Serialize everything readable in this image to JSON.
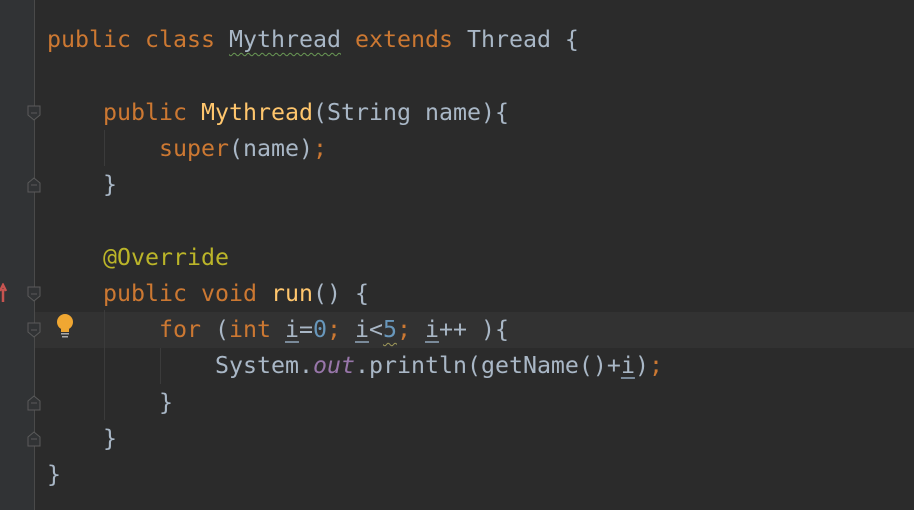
{
  "editor": {
    "colors": {
      "keyword": "#cc7832",
      "method": "#ffc66d",
      "number": "#6897bb",
      "annotation": "#bbb529",
      "field": "#9876aa",
      "text": "#a9b7c6",
      "background": "#2b2b2b"
    },
    "current_line": 9,
    "gutter_icons": {
      "line8": "override-arrow-icon",
      "line9": "lightbulb-icon"
    },
    "lines": [
      [
        {
          "c": "kw",
          "t": "public class "
        },
        {
          "c": "warn",
          "t": "Mythread"
        },
        {
          "c": "kw",
          "t": " extends "
        },
        {
          "c": "",
          "t": "Thread {"
        }
      ],
      [],
      [
        {
          "c": "",
          "t": "    "
        },
        {
          "c": "kw",
          "t": "public "
        },
        {
          "c": "fn",
          "t": "Mythread"
        },
        {
          "c": "",
          "t": "(String name){"
        }
      ],
      [
        {
          "c": "",
          "t": "        "
        },
        {
          "c": "kw",
          "t": "super"
        },
        {
          "c": "",
          "t": "(name)"
        },
        {
          "c": "kw",
          "t": ";"
        }
      ],
      [
        {
          "c": "",
          "t": "    }"
        }
      ],
      [],
      [
        {
          "c": "",
          "t": "    "
        },
        {
          "c": "ann",
          "t": "@Override"
        }
      ],
      [
        {
          "c": "",
          "t": "    "
        },
        {
          "c": "kw",
          "t": "public void "
        },
        {
          "c": "fn",
          "t": "run"
        },
        {
          "c": "",
          "t": "() {"
        }
      ],
      [
        {
          "c": "",
          "t": "        "
        },
        {
          "c": "kw",
          "t": "for "
        },
        {
          "c": "",
          "t": "("
        },
        {
          "c": "kw",
          "t": "int "
        },
        {
          "c": "var",
          "t": "i"
        },
        {
          "c": "",
          "t": "="
        },
        {
          "c": "num",
          "t": "0"
        },
        {
          "c": "kw",
          "t": "; "
        },
        {
          "c": "var",
          "t": "i"
        },
        {
          "c": "",
          "t": "<"
        },
        {
          "c": "num weak",
          "t": "5"
        },
        {
          "c": "kw",
          "t": "; "
        },
        {
          "c": "var",
          "t": "i"
        },
        {
          "c": "",
          "t": "++ ){"
        }
      ],
      [
        {
          "c": "",
          "t": "            System."
        },
        {
          "c": "fld",
          "t": "out"
        },
        {
          "c": "",
          "t": ".println(getName()+"
        },
        {
          "c": "var",
          "t": "i"
        },
        {
          "c": "",
          "t": ")"
        },
        {
          "c": "kw",
          "t": ";"
        }
      ],
      [
        {
          "c": "",
          "t": "        }"
        }
      ],
      [
        {
          "c": "",
          "t": "    }"
        }
      ],
      [
        {
          "c": "",
          "t": "}"
        }
      ]
    ]
  }
}
